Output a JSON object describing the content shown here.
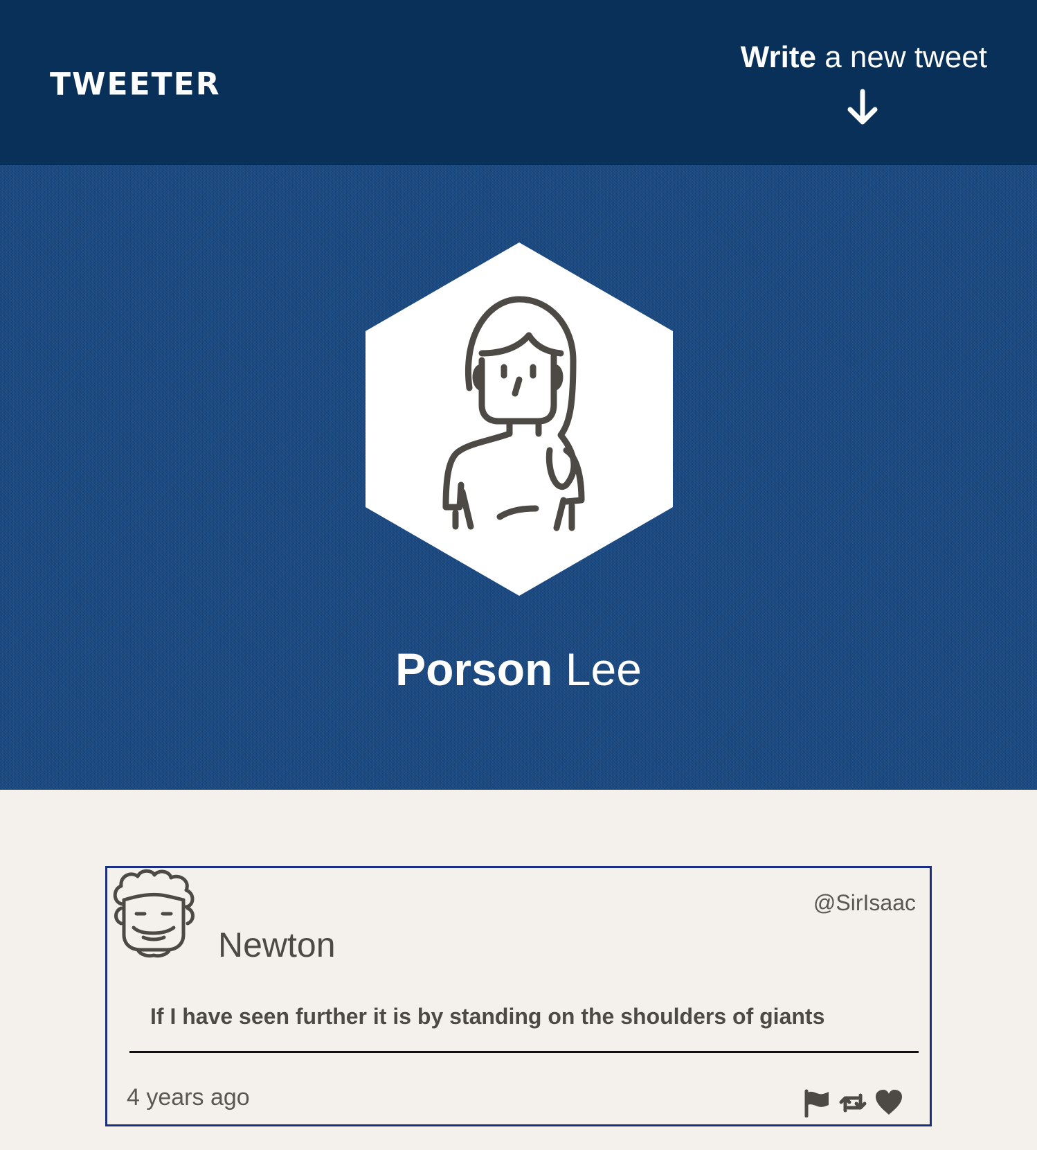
{
  "header": {
    "logo": "TWEETER",
    "compose_bold": "Write",
    "compose_rest": " a new tweet",
    "compose_icon": "arrow-down-icon"
  },
  "profile": {
    "first_name": "Porson",
    "last_name": "Lee",
    "avatar_icon": "woman-avatar-icon"
  },
  "tweet": {
    "name": "Newton",
    "handle": "@SirIsaac",
    "text": "If I have seen further it is by standing on the shoulders of giants",
    "time": "4 years ago",
    "avatar_icon": "man-avatar-icon",
    "actions": [
      "flag-icon",
      "retweet-icon",
      "heart-icon"
    ]
  },
  "colors": {
    "header_bg": "#083058",
    "profile_bg": "#1a4c88",
    "page_bg": "#f4f1ed",
    "card_border": "#1b2f80",
    "icon_stroke": "#4d4945"
  }
}
